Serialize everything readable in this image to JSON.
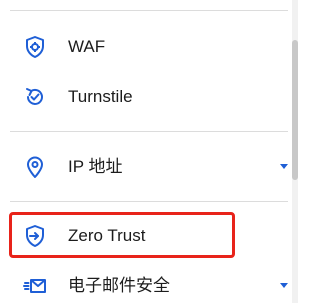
{
  "menu": {
    "items": [
      {
        "label": "WAF",
        "icon": "shield-gear-icon",
        "has_dropdown": false
      },
      {
        "label": "Turnstile",
        "icon": "refresh-check-icon",
        "has_dropdown": false
      },
      {
        "label": "IP 地址",
        "icon": "location-pin-icon",
        "has_dropdown": true
      },
      {
        "label": "Zero Trust",
        "icon": "shield-arrow-icon",
        "has_dropdown": false,
        "highlighted": true
      },
      {
        "label": "电子邮件安全",
        "icon": "email-send-icon",
        "has_dropdown": true
      }
    ]
  },
  "colors": {
    "icon": "#1f5fd6",
    "highlight_border": "#e8231a",
    "divider": "#dcdcdc",
    "text": "#1c1c1c"
  }
}
